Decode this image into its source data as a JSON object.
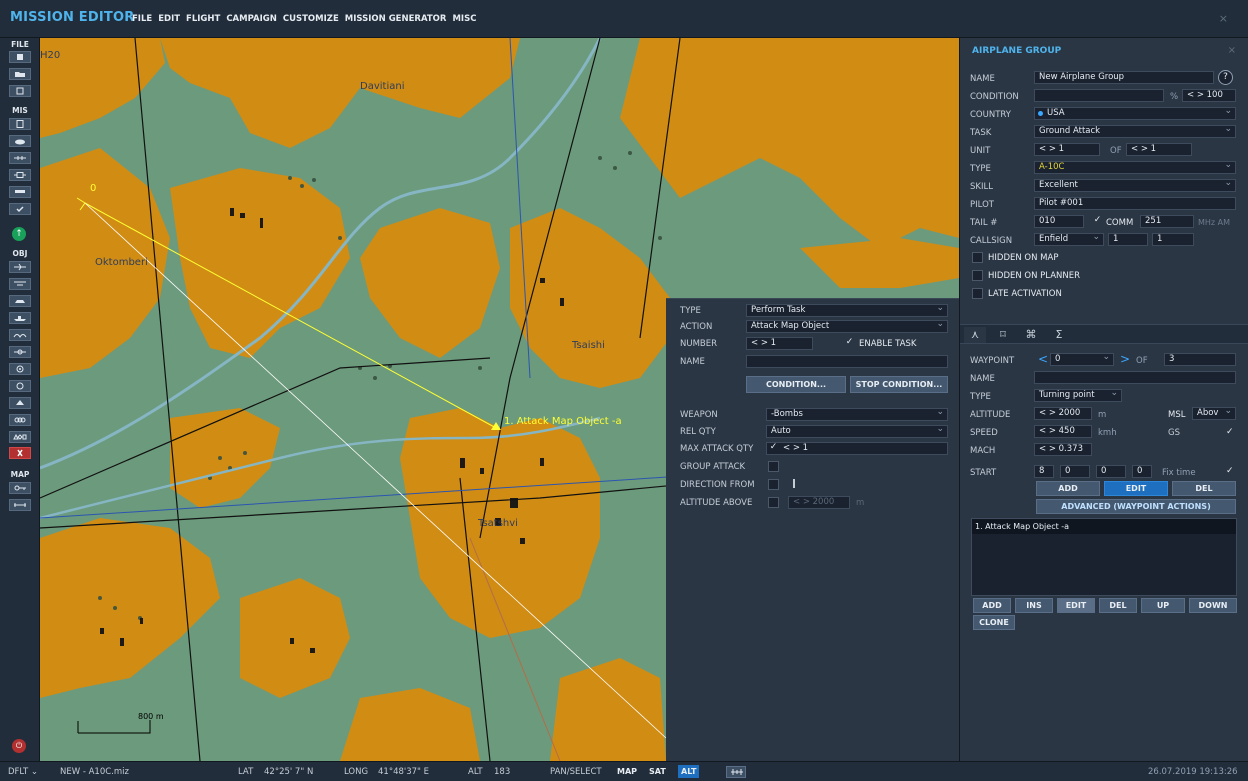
{
  "app": {
    "title": "MISSION EDITOR",
    "close": "×"
  },
  "menu": [
    "FILE",
    "EDIT",
    "FLIGHT",
    "CAMPAIGN",
    "CUSTOMIZE",
    "MISSION GENERATOR",
    "MISC"
  ],
  "toolbar": {
    "file": "FILE",
    "mis": "MIS",
    "obj": "OBJ",
    "map": "MAP"
  },
  "map": {
    "labels": {
      "h20": "H20",
      "davitiani": "Davitiani",
      "oktomberi": "Oktomberi",
      "tsaishi": "Tsaishi",
      "tsatshvi": "Tsatshvi",
      "waypoint0": "0",
      "waypoint1": "1. Attack Map Object -a",
      "scale": "800 m"
    }
  },
  "task": {
    "type_label": "TYPE",
    "type_value": "Perform Task",
    "action_label": "ACTION",
    "action_value": "Attack Map Object",
    "number_label": "NUMBER",
    "number_value": "< > 1",
    "enable_label": "ENABLE TASK",
    "enable_check": "✓",
    "name_label": "NAME",
    "name_value": "",
    "condition_btn": "CONDITION...",
    "stop_condition_btn": "STOP CONDITION...",
    "weapon_label": "WEAPON",
    "weapon_value": "-Bombs",
    "relqty_label": "REL QTY",
    "relqty_value": "Auto",
    "maxattack_label": "MAX ATTACK QTY",
    "maxattack_check": "✓",
    "maxattack_value": "< > 1",
    "groupattack_label": "GROUP ATTACK",
    "direction_label": "DIRECTION FROM",
    "altabove_label": "ALTITUDE ABOVE",
    "altabove_value": "< > 2000",
    "altabove_unit": "m"
  },
  "group": {
    "title": "AIRPLANE GROUP",
    "close": "×",
    "name_label": "NAME",
    "name_value": "New Airplane Group",
    "help": "?",
    "condition_label": "CONDITION",
    "condition_value": "",
    "condition_pct": "%",
    "condition_prob": "< > 100",
    "country_label": "COUNTRY",
    "country_value": "USA",
    "task_label": "TASK",
    "task_value": "Ground Attack",
    "unit_label": "UNIT",
    "unit_value": "< > 1",
    "unit_of": "OF",
    "unit_total": "< > 1",
    "type_label": "TYPE",
    "type_value": "A-10C",
    "skill_label": "SKILL",
    "skill_value": "Excellent",
    "pilot_label": "PILOT",
    "pilot_value": "Pilot #001",
    "tail_label": "TAIL #",
    "tail_value": "010",
    "comm_check": "✓",
    "comm_label": "COMM",
    "comm_value": "251",
    "comm_unit": "MHz AM",
    "callsign_label": "CALLSIGN",
    "callsign_value": "Enfield",
    "callsign_num1": "1",
    "callsign_num2": "1",
    "hidden_map": "HIDDEN ON MAP",
    "hidden_planner": "HIDDEN ON PLANNER",
    "late_activation": "LATE ACTIVATION"
  },
  "waypoint": {
    "tabs": [
      "⋏",
      "⌑",
      "⌘",
      "Σ"
    ],
    "wp_label": "WAYPOINT",
    "wp_prev": "<",
    "wp_value": "0",
    "wp_next": ">",
    "wp_of": "OF",
    "wp_total": "3",
    "name_label": "NAME",
    "name_value": "",
    "type_label": "TYPE",
    "type_value": "Turning point",
    "alt_label": "ALTITUDE",
    "alt_value": "< > 2000",
    "alt_unit": "m",
    "alt_ref": "MSL",
    "alt_mode": "Abov",
    "speed_label": "SPEED",
    "speed_value": "< > 450",
    "speed_unit": "kmh",
    "speed_ref": "GS",
    "speed_check": "✓",
    "mach_label": "MACH",
    "mach_value": "< > 0.373",
    "start_label": "START",
    "start_h": "8",
    "start_m": "0",
    "start_s": "0",
    "start_d": "0",
    "fixtime_label": "Fix time",
    "fixtime_check": "✓",
    "add_btn": "ADD",
    "edit_btn": "EDIT",
    "del_btn": "DEL",
    "advanced_btn": "ADVANCED (WAYPOINT ACTIONS)",
    "list_item": "1. Attack Map Object -a",
    "list_add": "ADD",
    "list_ins": "INS",
    "list_edit": "EDIT",
    "list_del": "DEL",
    "list_up": "UP",
    "list_down": "DOWN",
    "list_clone": "CLONE"
  },
  "status": {
    "dflt": "DFLT",
    "file": "NEW - A10C.miz",
    "lat_label": "LAT",
    "lat_value": "42°25' 7\" N",
    "long_label": "LONG",
    "long_value": "41°48'37\" E",
    "alt_label": "ALT",
    "alt_value": "183",
    "mode": "PAN/SELECT",
    "map_btn": "MAP",
    "sat_btn": "SAT",
    "alt_btn": "ALT",
    "datetime": "26.07.2019 19:13:26"
  }
}
